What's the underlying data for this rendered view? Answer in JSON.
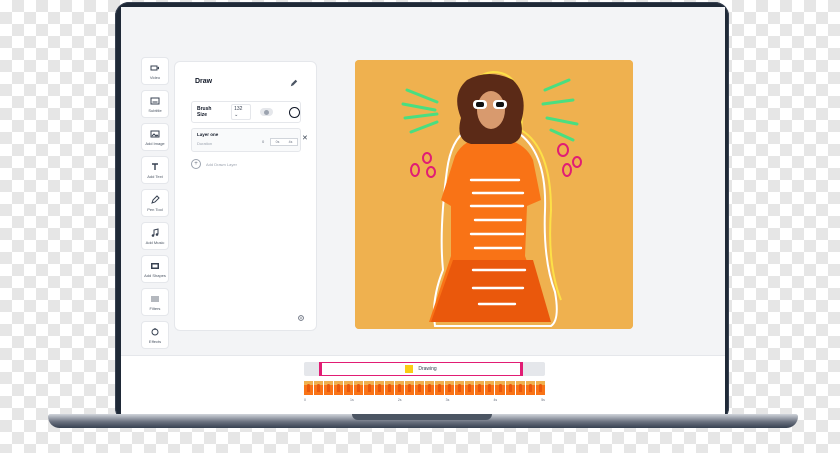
{
  "toolbar": {
    "items": [
      {
        "label": "Video",
        "icon": "video-camera-icon"
      },
      {
        "label": "Subtitle",
        "icon": "subtitle-icon"
      },
      {
        "label": "Add Image",
        "icon": "image-icon"
      },
      {
        "label": "Add Text",
        "icon": "text-icon"
      },
      {
        "label": "Pen Tool",
        "icon": "pen-icon"
      },
      {
        "label": "Add Music",
        "icon": "music-note-icon"
      },
      {
        "label": "Add Shapes",
        "icon": "shapes-icon"
      },
      {
        "label": "Filters",
        "icon": "filters-icon"
      },
      {
        "label": "Effects",
        "icon": "effects-icon"
      }
    ]
  },
  "panel": {
    "title": "Draw",
    "brush_size_label": "Brush Size",
    "brush_size_value": "132 ⌄",
    "layer": {
      "name": "Layer one",
      "sublabel": "Duration",
      "start": "0",
      "range_from": "0s",
      "range_to": "4s"
    },
    "add_layer_label": "Add Drawn Layer"
  },
  "timeline": {
    "clip_label": "Drawing",
    "clip_color": "#facc15",
    "frame_count": 24,
    "ticks": [
      "0",
      "1s",
      "2s",
      "3s",
      "4s",
      "5s"
    ]
  },
  "colors": {
    "accent": "#e11d74",
    "canvas_background": "#efb14f",
    "dress": "#f97316"
  }
}
